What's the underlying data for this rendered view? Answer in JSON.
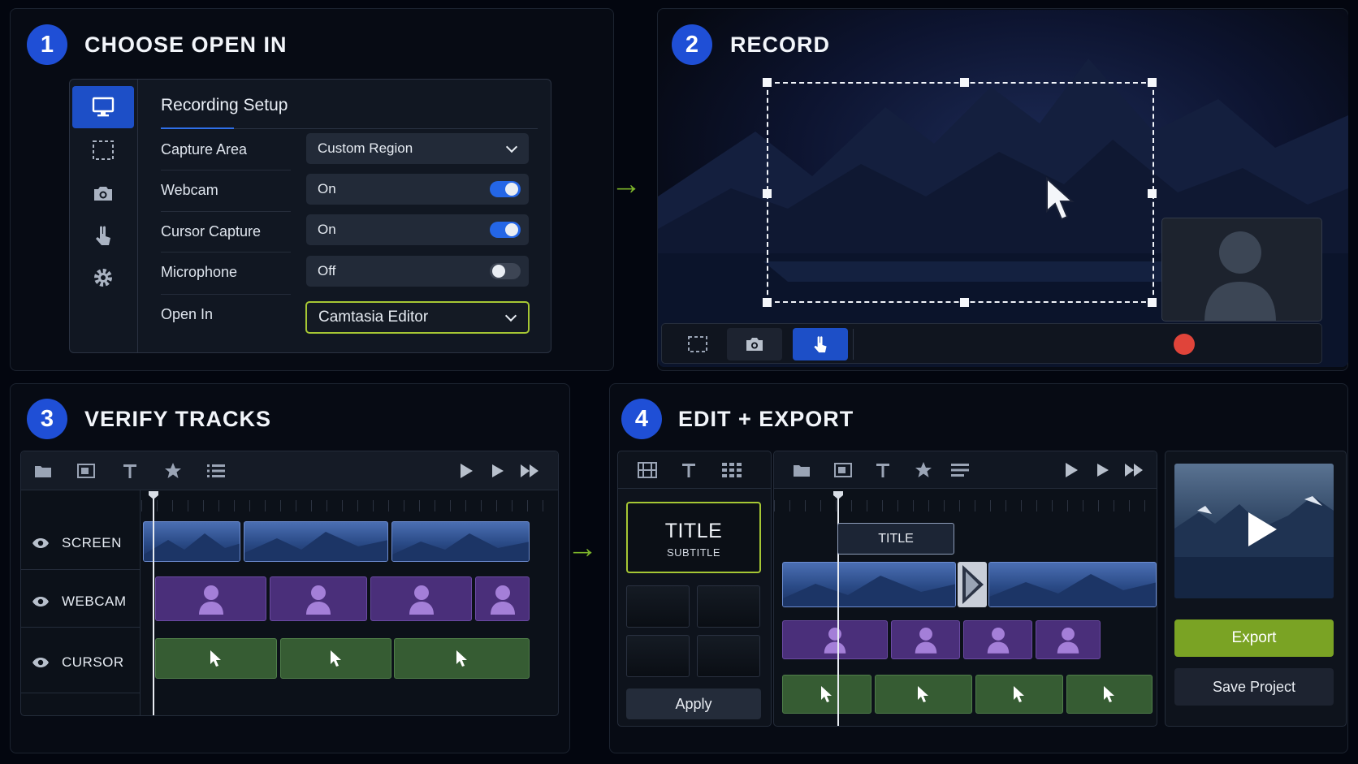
{
  "steps": [
    {
      "number": "1",
      "title": "CHOOSE OPEN IN"
    },
    {
      "number": "2",
      "title": "RECORD"
    },
    {
      "number": "3",
      "title": "VERIFY TRACKS"
    },
    {
      "number": "4",
      "title": "EDIT + EXPORT"
    }
  ],
  "arrows": {
    "glyph": "→",
    "color": "#7cb32a"
  },
  "recording_setup": {
    "title": "Recording Setup",
    "sidebar_icons": [
      "monitor-icon",
      "region-select-icon",
      "camera-icon",
      "cursor-click-icon",
      "gear-icon"
    ],
    "rows": [
      {
        "label": "Capture Area",
        "value": "Custom Region",
        "control": "dropdown"
      },
      {
        "label": "Webcam",
        "value": "On",
        "control": "toggle",
        "state": true
      },
      {
        "label": "Cursor Capture",
        "value": "On",
        "control": "toggle",
        "state": true
      },
      {
        "label": "Microphone",
        "value": "Off",
        "control": "toggle",
        "state": false
      },
      {
        "label": "Open In",
        "value": "Camtasia Editor",
        "control": "dropdown",
        "highlighted": true
      }
    ]
  },
  "record": {
    "toolbar_icons": [
      "region-select-icon",
      "camera-icon",
      "cursor-click-icon"
    ],
    "active_tool": "cursor-click-icon",
    "record_button_color": "#e0443a"
  },
  "verify_tracks": {
    "toolbar_icons": [
      "folder-icon",
      "media-icon",
      "text-icon",
      "star-icon",
      "list-icon"
    ],
    "playback_icons": [
      "play-icon",
      "step-forward-icon",
      "fast-forward-icon"
    ],
    "tracks": [
      {
        "name": "SCREEN",
        "type": "screen"
      },
      {
        "name": "WEBCAM",
        "type": "webcam"
      },
      {
        "name": "CURSOR",
        "type": "cursor"
      }
    ]
  },
  "edit_export": {
    "left_toolbar_icons": [
      "film-icon",
      "text-icon",
      "grid-icon"
    ],
    "title_card": {
      "title": "TITLE",
      "subtitle": "SUBTITLE"
    },
    "apply_label": "Apply",
    "timeline_title_clip": "TITLE",
    "export_label": "Export",
    "save_label": "Save Project",
    "accent": "#7aa324"
  }
}
